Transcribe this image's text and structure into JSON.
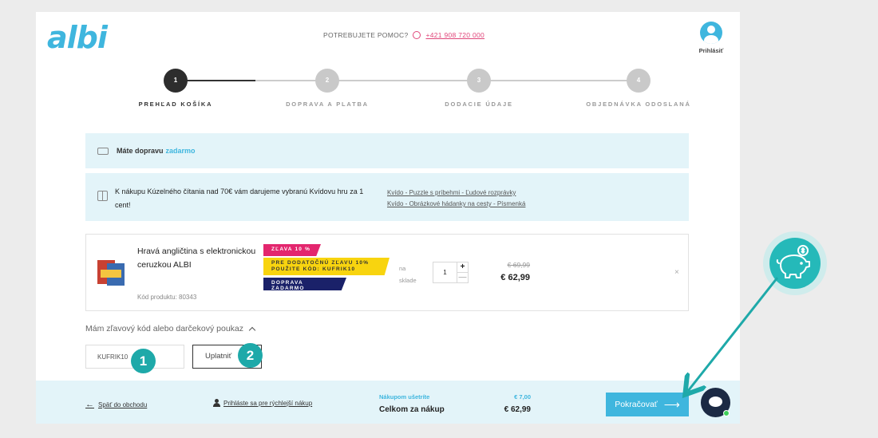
{
  "header": {
    "logo": "albi",
    "help_label": "POTREBUJETE POMOC?",
    "phone": "+421 908 720 000",
    "user_label": "Prihlásiť"
  },
  "steps": [
    {
      "num": "1",
      "label": "PREHĽAD KOŠÍKA",
      "active": true
    },
    {
      "num": "2",
      "label": "DOPRAVA A PLATBA",
      "active": false
    },
    {
      "num": "3",
      "label": "DODACIE ÚDAJE",
      "active": false
    },
    {
      "num": "4",
      "label": "OBJEDNÁVKA ODOSLANÁ",
      "active": false
    }
  ],
  "shipping_notice": {
    "text": "Máte dopravu",
    "accent": "zadarmo"
  },
  "gift_notice": {
    "text": "K nákupu Kúzelného čítania nad 70€ vám darujeme vybranú Kvídovu hru za 1 cent!",
    "links": [
      "Kvído - Puzzle s príbehmi - Ľudové rozprávky",
      "Kvído - Obrázkové hádanky na cesty - Písmenká"
    ]
  },
  "item": {
    "name": "Hravá angličtina s elektronickou ceruzkou ALBI",
    "code": "Kód produktu: 80343",
    "badge_discount": "ZĽAVA 10 %",
    "badge_extra_1": "PRE DODATOČNÚ ZĽAVU 10%",
    "badge_extra_2": "POUŽITE KÓD: KUFRIK10",
    "badge_shipping": "DOPRAVA ZADARMO",
    "stock_1": "na",
    "stock_2": "sklade",
    "qty": "1",
    "plus": "+",
    "minus": "—",
    "old_price": "€ 69,99",
    "price": "€ 62,99",
    "remove": "×"
  },
  "promo": {
    "toggle_label": "Mám zľavový kód alebo darčekový poukaz",
    "code_value": "KUFRIK10",
    "apply_label": "Uplatniť"
  },
  "annotations": [
    "1",
    "2"
  ],
  "footer": {
    "back_label": "Späť do obchodu",
    "login_label": "Prihláste sa pre rýchlejší nákup",
    "savings_label": "Nákupom ušetríte",
    "savings_value": "€ 7,00",
    "total_label": "Celkom za nákup",
    "total_value": "€ 62,99",
    "continue_label": "Pokračovať"
  },
  "colors": {
    "accent": "#3fb6de",
    "teal": "#1ea9a9",
    "pink": "#e3266e",
    "yellow": "#f8d40f",
    "navy": "#1a2169"
  }
}
